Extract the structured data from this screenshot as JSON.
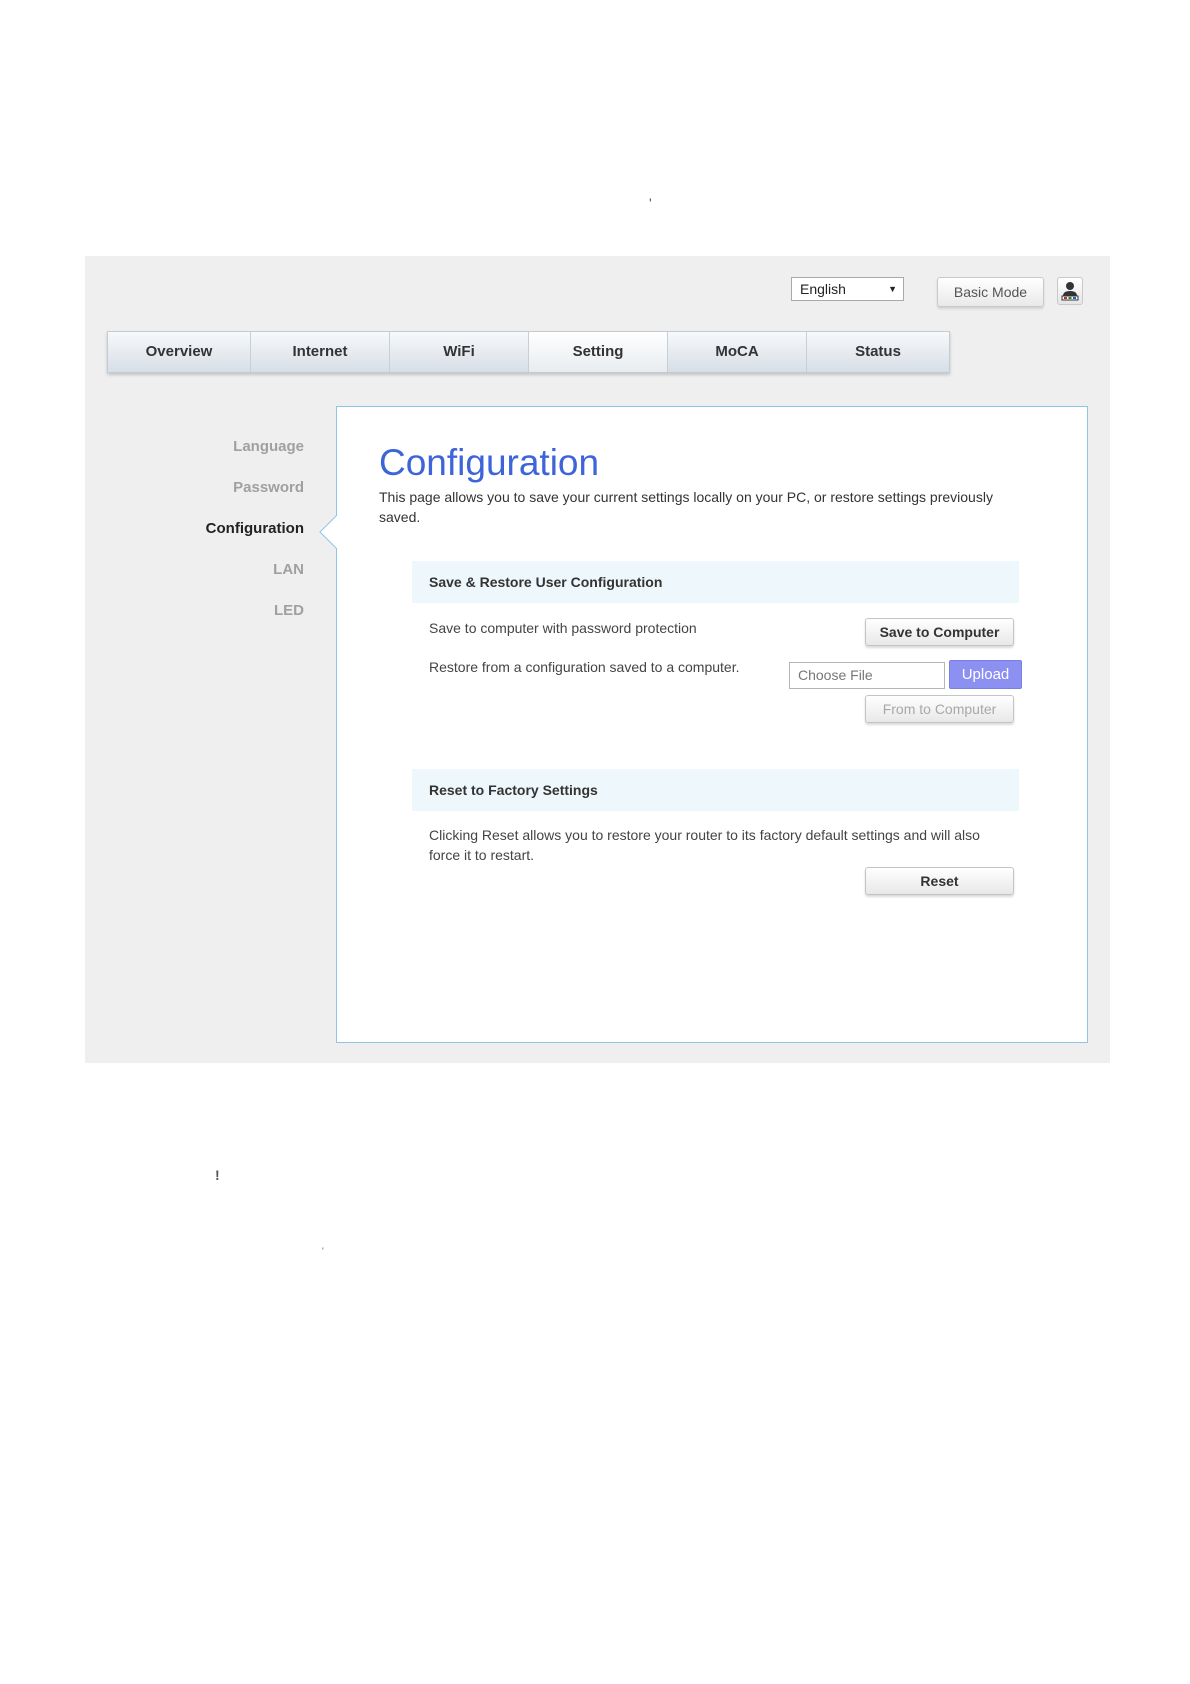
{
  "stray_marks": {
    "mark_1": "'",
    "mark_2": "!",
    "mark_3": "'"
  },
  "header": {
    "language_value": "English",
    "language_caret": "▼",
    "basic_mode_label": "Basic Mode",
    "account_icon": "user-admin-icon"
  },
  "tabs": [
    {
      "label": "Overview",
      "active": false
    },
    {
      "label": "Internet",
      "active": false
    },
    {
      "label": "WiFi",
      "active": false
    },
    {
      "label": "Setting",
      "active": true
    },
    {
      "label": "MoCA",
      "active": false
    },
    {
      "label": "Status",
      "active": false
    }
  ],
  "sidebar": {
    "items": [
      {
        "label": "Language",
        "active": false
      },
      {
        "label": "Password",
        "active": false
      },
      {
        "label": "Configuration",
        "active": true
      },
      {
        "label": "LAN",
        "active": false
      },
      {
        "label": "LED",
        "active": false
      }
    ]
  },
  "main": {
    "title": "Configuration",
    "description": "This page allows you to save your current settings locally on your PC, or restore settings previously saved.",
    "save_restore": {
      "header": "Save & Restore User Configuration",
      "save_text": "Save to computer with password protection",
      "save_button": "Save to Computer",
      "restore_text": "Restore from a configuration saved to a computer.",
      "choose_file_label": "Choose File",
      "upload_label": "Upload",
      "from_computer_label": "From to Computer"
    },
    "reset": {
      "header": "Reset to Factory Settings",
      "text": "Clicking Reset allows you to restore your router to its factory default settings and will also force it to restart.",
      "button": "Reset"
    }
  },
  "colors": {
    "title_blue": "#3d64d8",
    "upload_button": "#8c90f0",
    "panel_border": "#8ec5e6",
    "section_header_bg": "#eef7fb",
    "page_background": "#efefef"
  }
}
